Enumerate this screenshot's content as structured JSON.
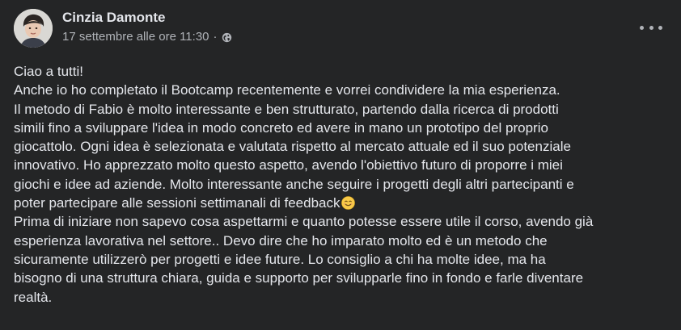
{
  "post": {
    "author": "Cinzia Damonte",
    "timestamp": "17 settembre alle ore 11:30",
    "separator": "·",
    "privacy_icon": "globe-icon",
    "menu_icon": "more-options-icon",
    "lines": [
      "Ciao a tutti!",
      "Anche io ho completato il Bootcamp recentemente e vorrei condividere la mia esperienza.",
      "Il metodo di Fabio è molto interessante e ben strutturato, partendo dalla ricerca di prodotti",
      "simili fino a sviluppare l'idea in modo concreto ed avere in mano un prototipo del proprio",
      "giocattolo. Ogni idea è selezionata e valutata rispetto al mercato attuale ed il suo potenziale",
      "innovativo. Ho apprezzato molto questo aspetto, avendo l'obiettivo futuro di proporre i miei",
      "giochi e idee ad aziende. Molto interessante anche seguire i progetti degli altri partecipanti e",
      "poter partecipare alle sessioni settimanali di feedback",
      "Prima di iniziare non sapevo cosa aspettarmi e quanto potesse essere utile il corso, avendo già",
      "esperienza lavorativa nel settore.. Devo dire che ho imparato molto ed è un metodo che",
      "sicuramente utilizzerò per progetti e idee future. Lo consiglio a chi ha molte idee, ma ha",
      "bisogno di una struttura chiara, guida e supporto per svilupparle fino in fondo e farle diventare",
      "realtà."
    ],
    "emoji_icon": "smiling-face-emoji-icon"
  },
  "colors": {
    "background": "#242526",
    "primary_text": "#e4e6eb",
    "secondary_text": "#b0b3b8"
  }
}
